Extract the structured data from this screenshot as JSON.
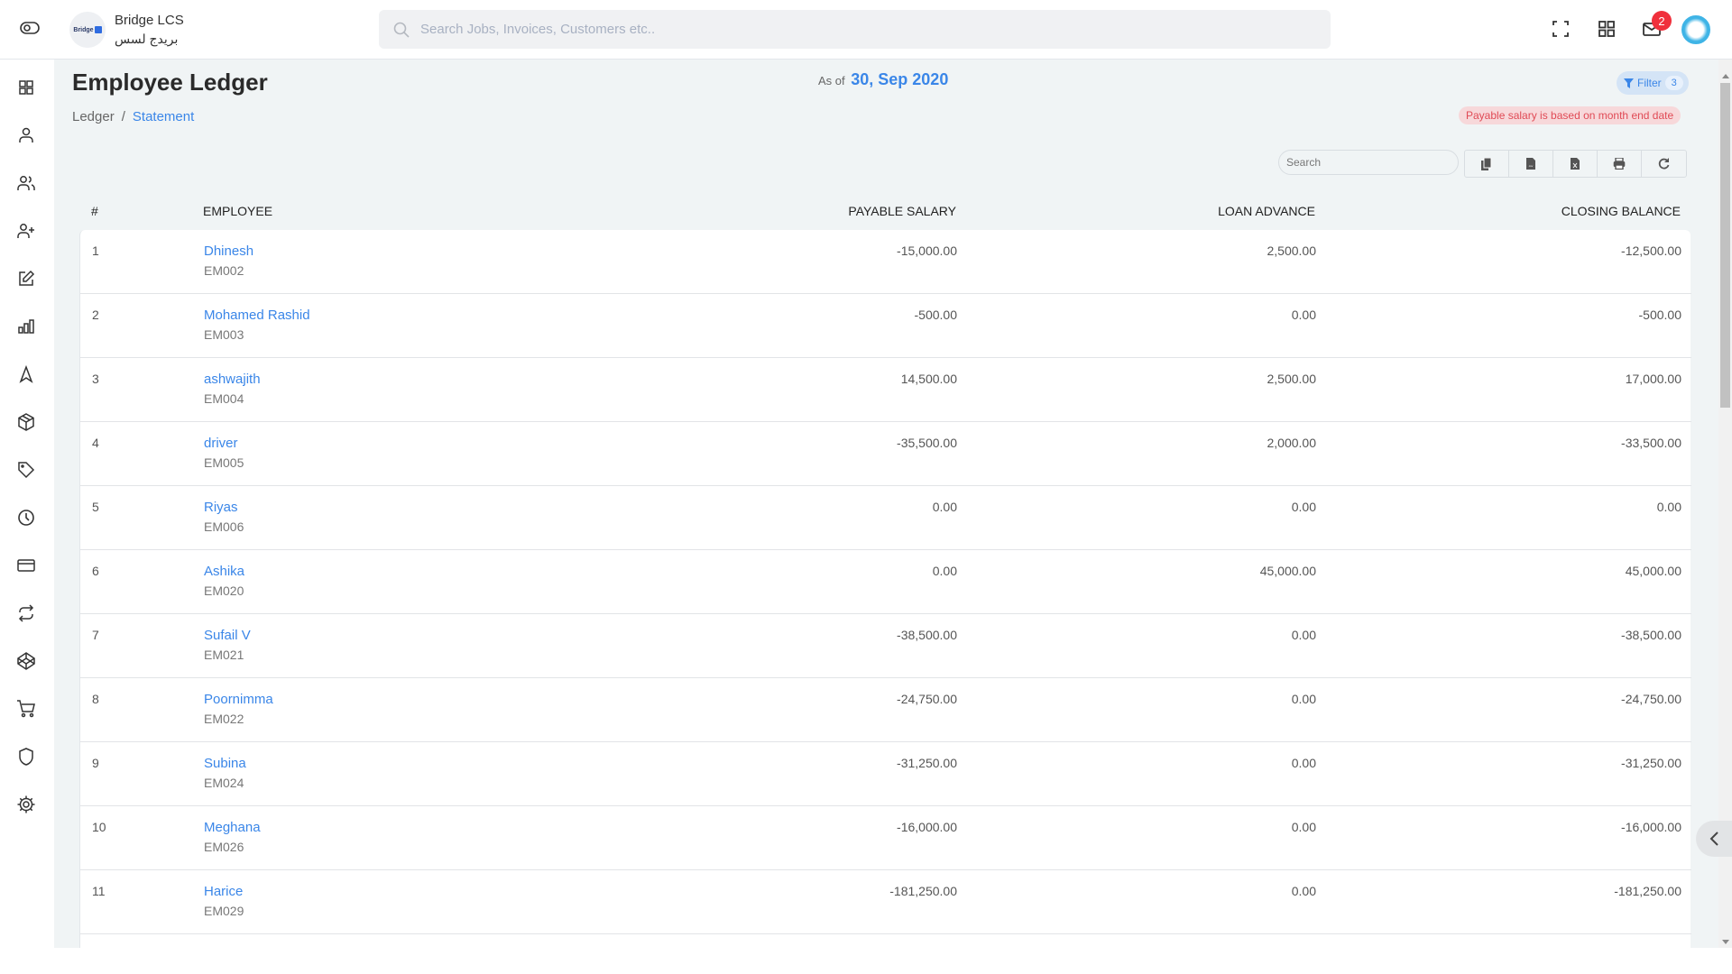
{
  "header": {
    "brand_name": "Bridge LCS",
    "brand_name_ar": "بريدج لسس",
    "logo_text": "Bridge",
    "search_placeholder": "Search Jobs, Invoices, Customers etc..",
    "notification_count": "2",
    "icons": [
      "sidebar-toggle-icon",
      "fullscreen-icon",
      "apps-grid-icon",
      "mail-icon",
      "user-avatar"
    ]
  },
  "sidebar": {
    "items": [
      {
        "name": "dashboard",
        "icon": "grid-icon"
      },
      {
        "name": "user",
        "icon": "user-icon"
      },
      {
        "name": "users",
        "icon": "users-icon"
      },
      {
        "name": "add-user",
        "icon": "user-plus-icon"
      },
      {
        "name": "edit",
        "icon": "edit-icon"
      },
      {
        "name": "reports",
        "icon": "bar-chart-icon"
      },
      {
        "name": "navigation",
        "icon": "navigation-icon"
      },
      {
        "name": "inventory",
        "icon": "box-icon"
      },
      {
        "name": "tags",
        "icon": "tag-icon"
      },
      {
        "name": "history",
        "icon": "clock-icon"
      },
      {
        "name": "payments",
        "icon": "credit-card-icon"
      },
      {
        "name": "transfers",
        "icon": "repeat-icon"
      },
      {
        "name": "codepen",
        "icon": "codepen-icon"
      },
      {
        "name": "purchases",
        "icon": "shopping-cart-icon"
      },
      {
        "name": "security",
        "icon": "shield-icon"
      },
      {
        "name": "settings",
        "icon": "settings-icon"
      }
    ]
  },
  "page": {
    "title": "Employee Ledger",
    "breadcrumb": [
      "Ledger",
      "Statement"
    ],
    "breadcrumb_sep": "/",
    "as_of_label": "As of",
    "as_of_date": "30, Sep 2020",
    "filter_label": "Filter",
    "filter_count": "3",
    "notice": "Payable salary is based on month end date",
    "table_search_placeholder": "Search",
    "toolbar_buttons": [
      "copy",
      "csv",
      "excel",
      "print",
      "refresh"
    ]
  },
  "table": {
    "columns": [
      "#",
      "EMPLOYEE",
      "PAYABLE SALARY",
      "LOAN ADVANCE",
      "CLOSING BALANCE"
    ],
    "rows": [
      {
        "num": "1",
        "name": "Dhinesh",
        "code": "EM002",
        "payable": "-15,000.00",
        "loan": "2,500.00",
        "closing": "-12,500.00"
      },
      {
        "num": "2",
        "name": "Mohamed Rashid",
        "code": "EM003",
        "payable": "-500.00",
        "loan": "0.00",
        "closing": "-500.00"
      },
      {
        "num": "3",
        "name": "ashwajith",
        "code": "EM004",
        "payable": "14,500.00",
        "loan": "2,500.00",
        "closing": "17,000.00"
      },
      {
        "num": "4",
        "name": "driver",
        "code": "EM005",
        "payable": "-35,500.00",
        "loan": "2,000.00",
        "closing": "-33,500.00"
      },
      {
        "num": "5",
        "name": "Riyas",
        "code": "EM006",
        "payable": "0.00",
        "loan": "0.00",
        "closing": "0.00"
      },
      {
        "num": "6",
        "name": "Ashika",
        "code": "EM020",
        "payable": "0.00",
        "loan": "45,000.00",
        "closing": "45,000.00"
      },
      {
        "num": "7",
        "name": "Sufail V",
        "code": "EM021",
        "payable": "-38,500.00",
        "loan": "0.00",
        "closing": "-38,500.00"
      },
      {
        "num": "8",
        "name": "Poornimma",
        "code": "EM022",
        "payable": "-24,750.00",
        "loan": "0.00",
        "closing": "-24,750.00"
      },
      {
        "num": "9",
        "name": "Subina",
        "code": "EM024",
        "payable": "-31,250.00",
        "loan": "0.00",
        "closing": "-31,250.00"
      },
      {
        "num": "10",
        "name": "Meghana",
        "code": "EM026",
        "payable": "-16,000.00",
        "loan": "0.00",
        "closing": "-16,000.00"
      },
      {
        "num": "11",
        "name": "Harice",
        "code": "EM029",
        "payable": "-181,250.00",
        "loan": "0.00",
        "closing": "-181,250.00"
      }
    ]
  },
  "colors": {
    "accent": "#3a86e8",
    "notice_text": "#e04a55",
    "notice_bg": "#f7d8da",
    "badge": "#f0303c",
    "page_bg": "#f0f4f5"
  }
}
